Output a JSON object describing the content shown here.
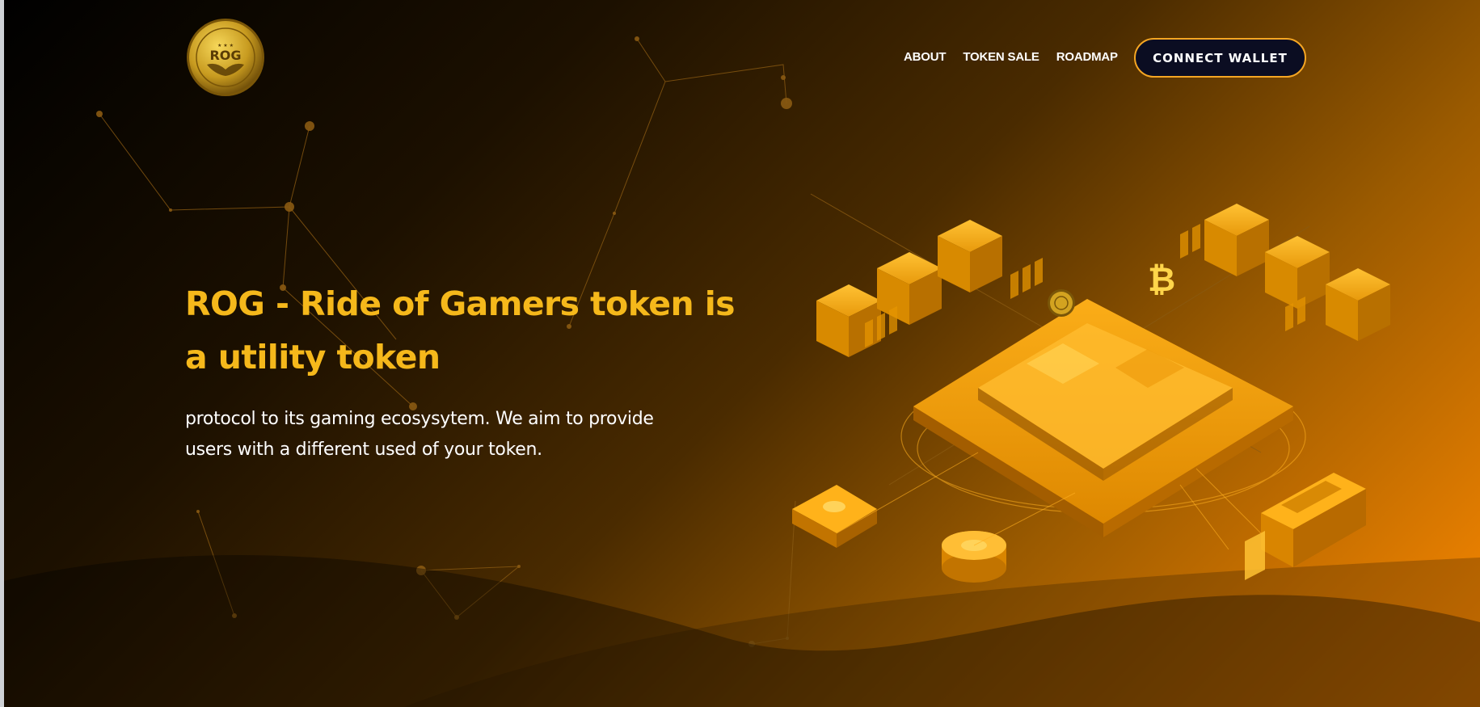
{
  "header": {
    "logo_text": "ROG",
    "nav": [
      {
        "label": "ABOUT"
      },
      {
        "label": "TOKEN SALE"
      },
      {
        "label": "ROADMAP"
      }
    ],
    "connect_wallet": "CONNECT WALLET"
  },
  "hero": {
    "title_line1": "ROG - Ride of Gamers token is",
    "title_line2": "a utility token",
    "text_line1": "protocol to its gaming ecosysytem. We aim to provide",
    "text_line2": "users with a different used of your token."
  },
  "icons": {
    "bitcoin": "₿"
  },
  "colors": {
    "accent": "#f5b81b",
    "button_bg": "#0b0d22",
    "button_border": "#f5a623",
    "gradient_end": "#ff8a00"
  }
}
